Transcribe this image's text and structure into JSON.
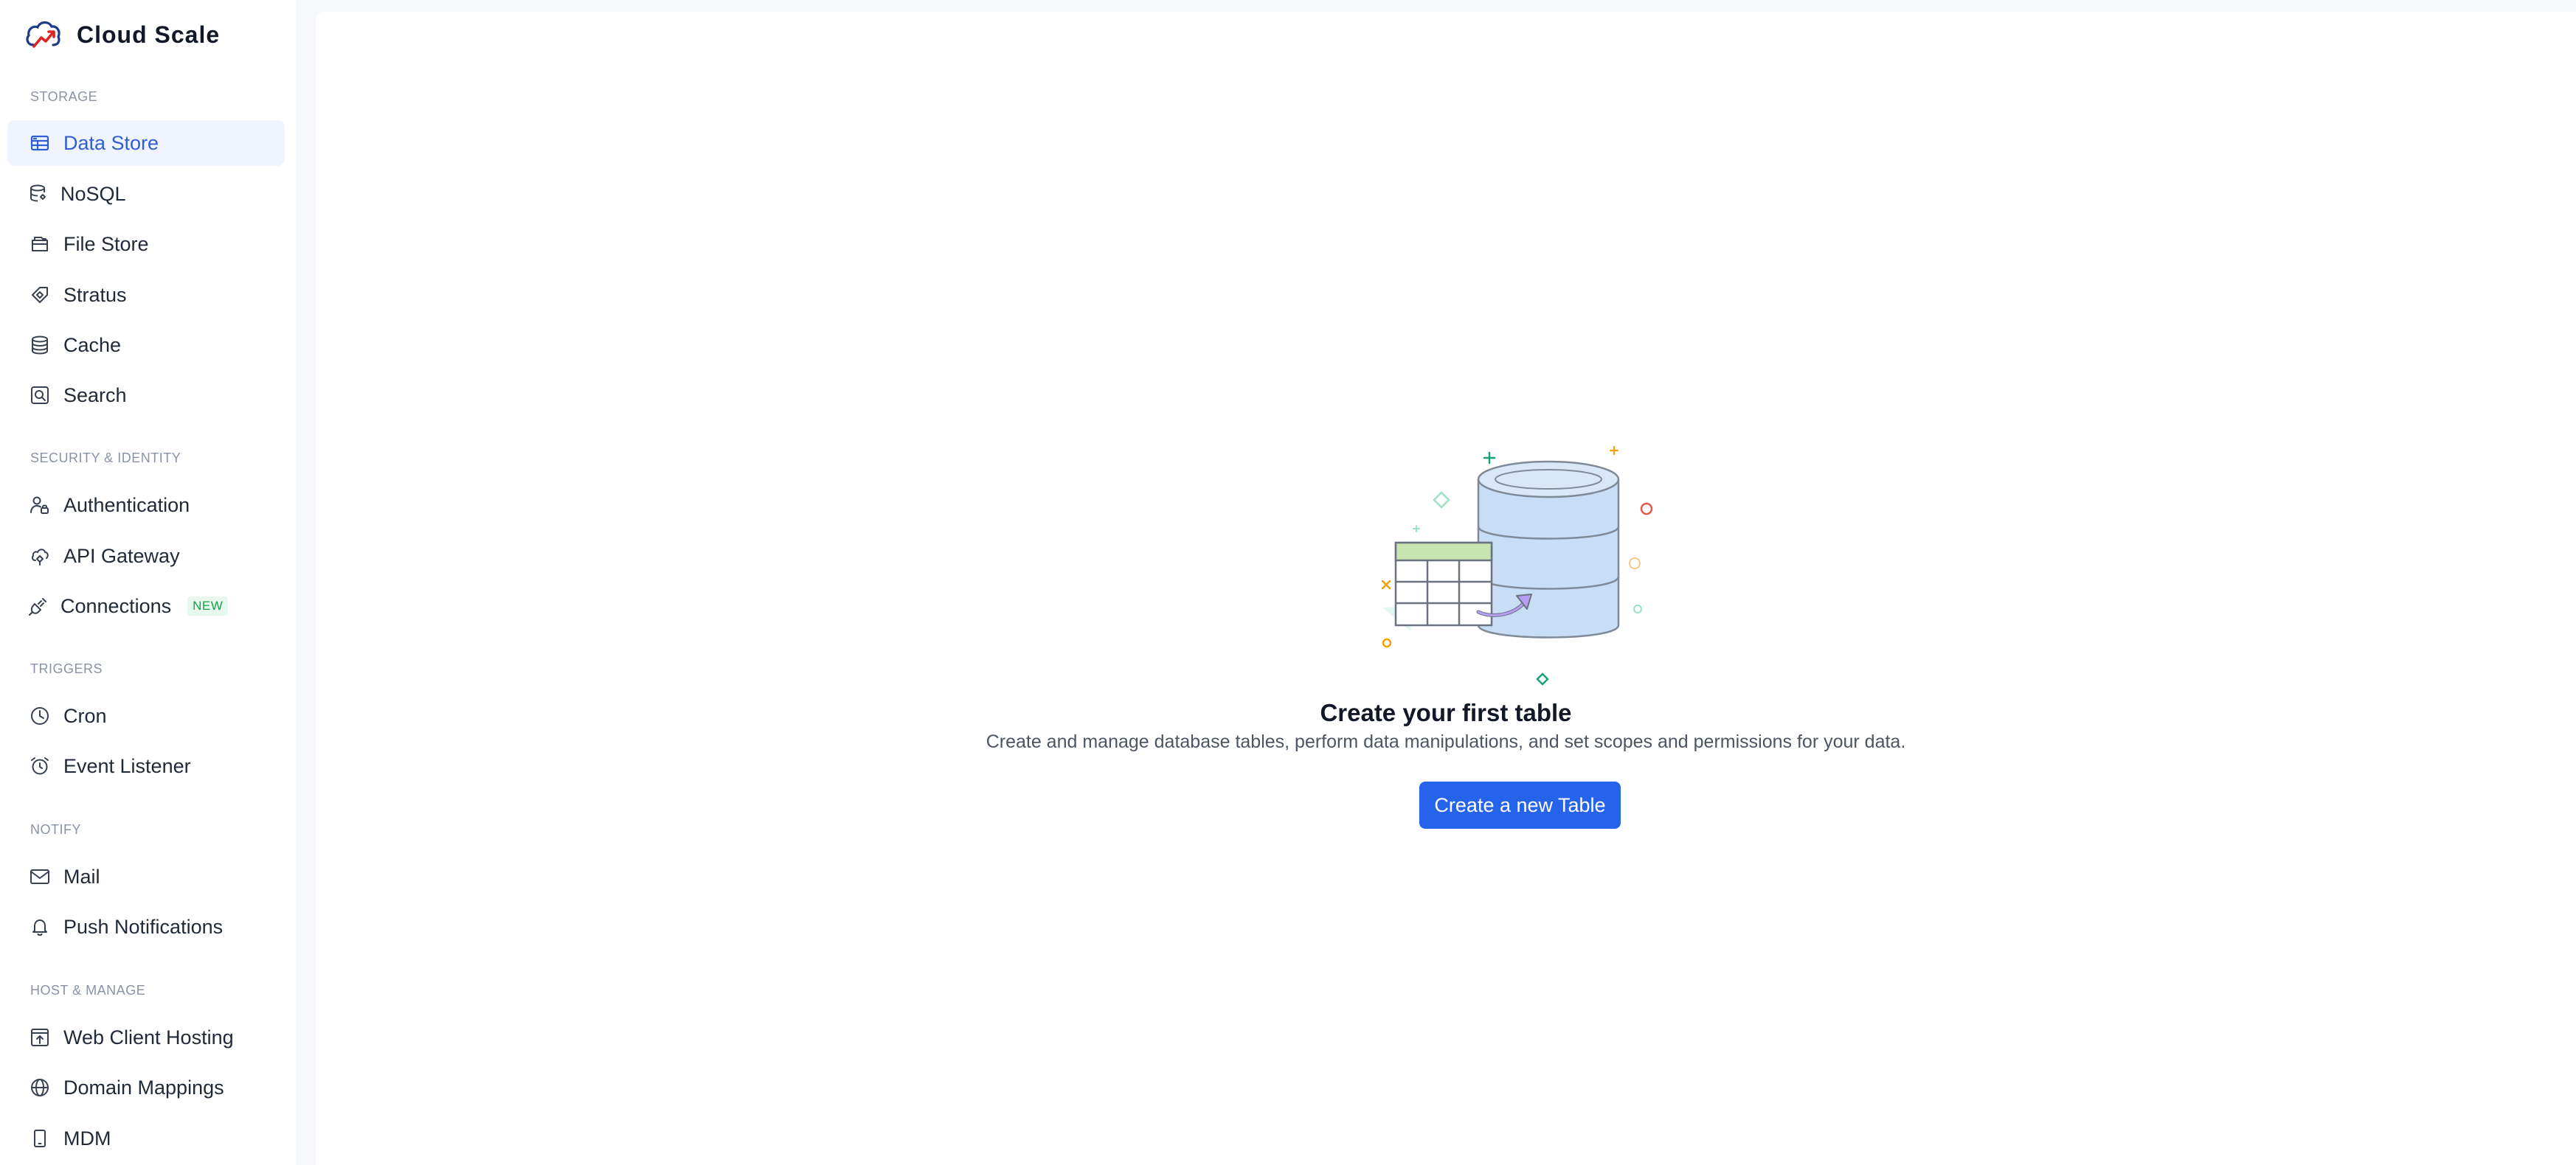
{
  "app": {
    "name": "Cloud Scale"
  },
  "sidebar": {
    "sections": [
      {
        "title": "STORAGE",
        "items": [
          {
            "label": "Data Store",
            "icon": "table-icon",
            "active": true
          },
          {
            "label": "NoSQL",
            "icon": "nosql-icon"
          },
          {
            "label": "File Store",
            "icon": "folder-icon"
          },
          {
            "label": "Stratus",
            "icon": "stratus-icon"
          },
          {
            "label": "Cache",
            "icon": "database-icon"
          },
          {
            "label": "Search",
            "icon": "search-icon"
          }
        ]
      },
      {
        "title": "SECURITY & IDENTITY",
        "items": [
          {
            "label": "Authentication",
            "icon": "user-lock-icon"
          },
          {
            "label": "API Gateway",
            "icon": "api-gateway-icon"
          },
          {
            "label": "Connections",
            "icon": "plug-icon",
            "badge": "NEW"
          }
        ]
      },
      {
        "title": "TRIGGERS",
        "items": [
          {
            "label": "Cron",
            "icon": "clock-icon"
          },
          {
            "label": "Event Listener",
            "icon": "alarm-icon"
          }
        ]
      },
      {
        "title": "NOTIFY",
        "items": [
          {
            "label": "Mail",
            "icon": "mail-icon"
          },
          {
            "label": "Push Notifications",
            "icon": "bell-icon"
          }
        ]
      },
      {
        "title": "HOST & MANAGE",
        "items": [
          {
            "label": "Web Client Hosting",
            "icon": "upload-window-icon"
          },
          {
            "label": "Domain Mappings",
            "icon": "globe-icon"
          },
          {
            "label": "MDM",
            "icon": "mobile-icon"
          }
        ]
      }
    ]
  },
  "main": {
    "empty_state": {
      "title": "Create your first table",
      "description": "Create and manage database tables, perform data manipulations, and set scopes and permissions for your data.",
      "button_label": "Create a new Table"
    }
  },
  "colors": {
    "accent": "#2563eb",
    "active_bg": "#eff4ff",
    "active_text": "#2f5fd0",
    "new_badge": "#16a34a"
  }
}
